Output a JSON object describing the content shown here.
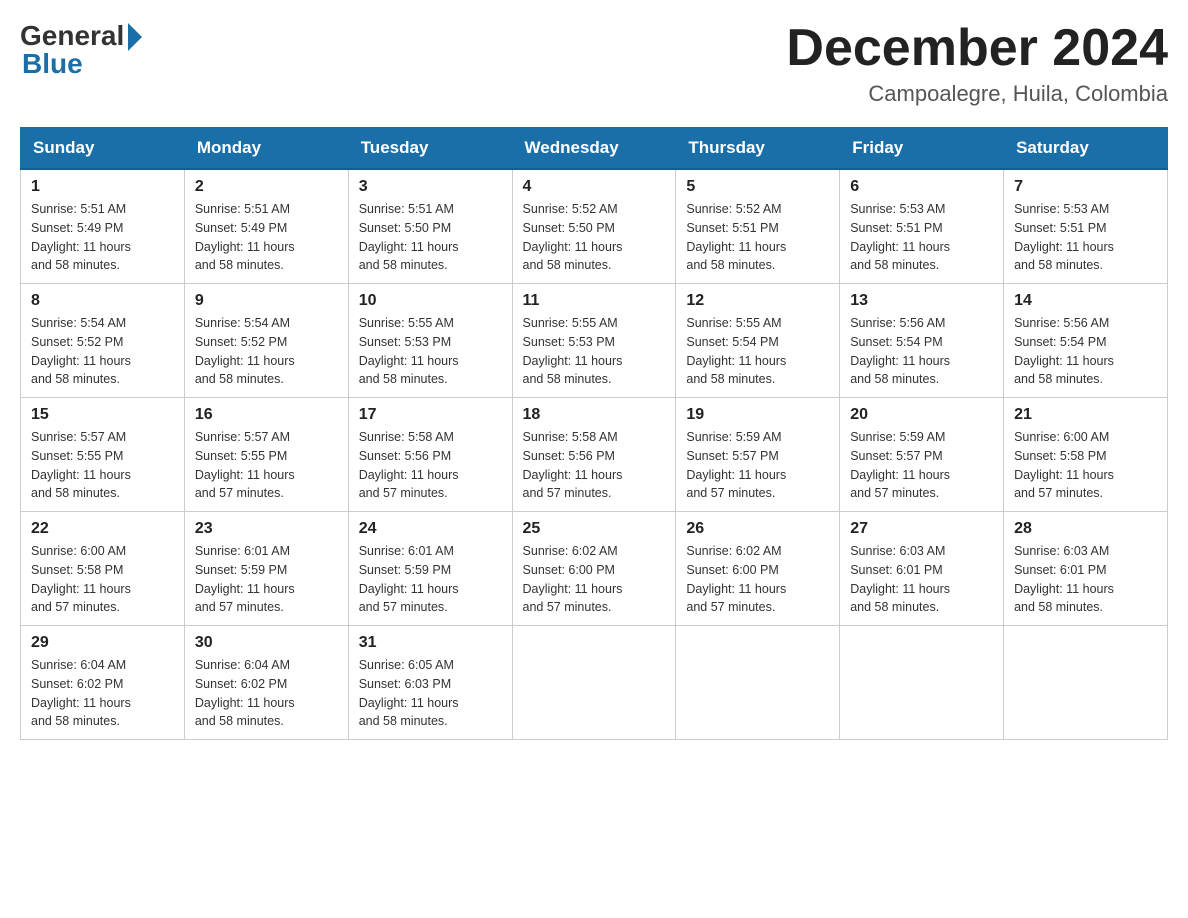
{
  "logo": {
    "general": "General",
    "blue": "Blue"
  },
  "title": {
    "month_year": "December 2024",
    "location": "Campoalegre, Huila, Colombia"
  },
  "days_of_week": [
    "Sunday",
    "Monday",
    "Tuesday",
    "Wednesday",
    "Thursday",
    "Friday",
    "Saturday"
  ],
  "weeks": [
    [
      {
        "day": "1",
        "sunrise": "5:51 AM",
        "sunset": "5:49 PM",
        "daylight": "11 hours and 58 minutes."
      },
      {
        "day": "2",
        "sunrise": "5:51 AM",
        "sunset": "5:49 PM",
        "daylight": "11 hours and 58 minutes."
      },
      {
        "day": "3",
        "sunrise": "5:51 AM",
        "sunset": "5:50 PM",
        "daylight": "11 hours and 58 minutes."
      },
      {
        "day": "4",
        "sunrise": "5:52 AM",
        "sunset": "5:50 PM",
        "daylight": "11 hours and 58 minutes."
      },
      {
        "day": "5",
        "sunrise": "5:52 AM",
        "sunset": "5:51 PM",
        "daylight": "11 hours and 58 minutes."
      },
      {
        "day": "6",
        "sunrise": "5:53 AM",
        "sunset": "5:51 PM",
        "daylight": "11 hours and 58 minutes."
      },
      {
        "day": "7",
        "sunrise": "5:53 AM",
        "sunset": "5:51 PM",
        "daylight": "11 hours and 58 minutes."
      }
    ],
    [
      {
        "day": "8",
        "sunrise": "5:54 AM",
        "sunset": "5:52 PM",
        "daylight": "11 hours and 58 minutes."
      },
      {
        "day": "9",
        "sunrise": "5:54 AM",
        "sunset": "5:52 PM",
        "daylight": "11 hours and 58 minutes."
      },
      {
        "day": "10",
        "sunrise": "5:55 AM",
        "sunset": "5:53 PM",
        "daylight": "11 hours and 58 minutes."
      },
      {
        "day": "11",
        "sunrise": "5:55 AM",
        "sunset": "5:53 PM",
        "daylight": "11 hours and 58 minutes."
      },
      {
        "day": "12",
        "sunrise": "5:55 AM",
        "sunset": "5:54 PM",
        "daylight": "11 hours and 58 minutes."
      },
      {
        "day": "13",
        "sunrise": "5:56 AM",
        "sunset": "5:54 PM",
        "daylight": "11 hours and 58 minutes."
      },
      {
        "day": "14",
        "sunrise": "5:56 AM",
        "sunset": "5:54 PM",
        "daylight": "11 hours and 58 minutes."
      }
    ],
    [
      {
        "day": "15",
        "sunrise": "5:57 AM",
        "sunset": "5:55 PM",
        "daylight": "11 hours and 58 minutes."
      },
      {
        "day": "16",
        "sunrise": "5:57 AM",
        "sunset": "5:55 PM",
        "daylight": "11 hours and 57 minutes."
      },
      {
        "day": "17",
        "sunrise": "5:58 AM",
        "sunset": "5:56 PM",
        "daylight": "11 hours and 57 minutes."
      },
      {
        "day": "18",
        "sunrise": "5:58 AM",
        "sunset": "5:56 PM",
        "daylight": "11 hours and 57 minutes."
      },
      {
        "day": "19",
        "sunrise": "5:59 AM",
        "sunset": "5:57 PM",
        "daylight": "11 hours and 57 minutes."
      },
      {
        "day": "20",
        "sunrise": "5:59 AM",
        "sunset": "5:57 PM",
        "daylight": "11 hours and 57 minutes."
      },
      {
        "day": "21",
        "sunrise": "6:00 AM",
        "sunset": "5:58 PM",
        "daylight": "11 hours and 57 minutes."
      }
    ],
    [
      {
        "day": "22",
        "sunrise": "6:00 AM",
        "sunset": "5:58 PM",
        "daylight": "11 hours and 57 minutes."
      },
      {
        "day": "23",
        "sunrise": "6:01 AM",
        "sunset": "5:59 PM",
        "daylight": "11 hours and 57 minutes."
      },
      {
        "day": "24",
        "sunrise": "6:01 AM",
        "sunset": "5:59 PM",
        "daylight": "11 hours and 57 minutes."
      },
      {
        "day": "25",
        "sunrise": "6:02 AM",
        "sunset": "6:00 PM",
        "daylight": "11 hours and 57 minutes."
      },
      {
        "day": "26",
        "sunrise": "6:02 AM",
        "sunset": "6:00 PM",
        "daylight": "11 hours and 57 minutes."
      },
      {
        "day": "27",
        "sunrise": "6:03 AM",
        "sunset": "6:01 PM",
        "daylight": "11 hours and 58 minutes."
      },
      {
        "day": "28",
        "sunrise": "6:03 AM",
        "sunset": "6:01 PM",
        "daylight": "11 hours and 58 minutes."
      }
    ],
    [
      {
        "day": "29",
        "sunrise": "6:04 AM",
        "sunset": "6:02 PM",
        "daylight": "11 hours and 58 minutes."
      },
      {
        "day": "30",
        "sunrise": "6:04 AM",
        "sunset": "6:02 PM",
        "daylight": "11 hours and 58 minutes."
      },
      {
        "day": "31",
        "sunrise": "6:05 AM",
        "sunset": "6:03 PM",
        "daylight": "11 hours and 58 minutes."
      },
      null,
      null,
      null,
      null
    ]
  ]
}
